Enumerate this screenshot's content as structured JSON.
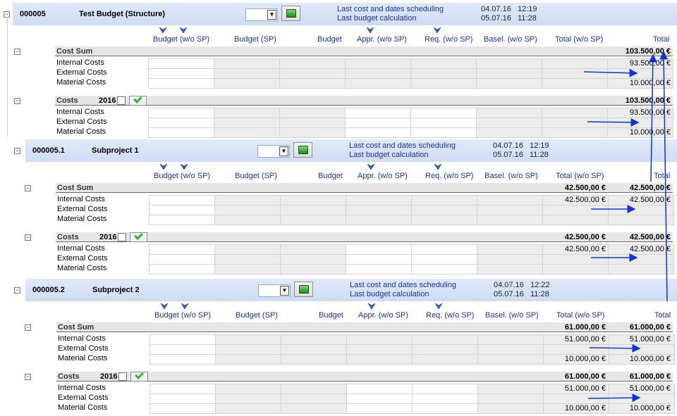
{
  "column_headers": [
    "Budget (w/o SP)",
    "Budget (SP)",
    "Budget",
    "Appr. (w/o SP)",
    "Req. (w/o SP)",
    "Basel. (w/o SP)",
    "Total (w/o SP)",
    "Total"
  ],
  "row_labels": [
    "Internal Costs",
    "External Costs",
    "Material Costs"
  ],
  "colors": {
    "accent": "#1b2fa8",
    "header_band": "#dae5f7",
    "arrow": "#1133dd"
  },
  "projects": [
    {
      "id": "000005",
      "name": "Test Budget (Structure)",
      "sched_label": "Last cost and dates scheduling",
      "calc_label": "Last budget calculation",
      "sched_date": "04.07.16",
      "sched_time": "12:19",
      "calc_date": "05.07.16",
      "calc_time": "11:28",
      "cost_sum": {
        "label": "Cost Sum",
        "total_wo_sp": "",
        "total": "103.500,00 €",
        "rows": [
          {
            "total_wo_sp": "",
            "total": "93.500,00 €"
          },
          {
            "total_wo_sp": "",
            "total": ""
          },
          {
            "total_wo_sp": "",
            "total": "10.000,00 €"
          }
        ]
      },
      "costs": {
        "label": "Costs",
        "year": "2016",
        "total_wo_sp": "",
        "total": "103.500,00 €",
        "rows": [
          {
            "total_wo_sp": "",
            "total": "93.500,00 €"
          },
          {
            "total_wo_sp": "",
            "total": ""
          },
          {
            "total_wo_sp": "",
            "total": "10.000,00 €"
          }
        ]
      }
    },
    {
      "id": "000005.1",
      "name": "Subproject 1",
      "sched_label": "Last cost and dates scheduling",
      "calc_label": "Last budget calculation",
      "sched_date": "04.07.16",
      "sched_time": "12:19",
      "calc_date": "05.07.16",
      "calc_time": "11:28",
      "cost_sum": {
        "label": "Cost Sum",
        "total_wo_sp": "42.500,00 €",
        "total": "42.500,00 €",
        "rows": [
          {
            "total_wo_sp": "42.500,00 €",
            "total": "42.500,00 €"
          },
          {
            "total_wo_sp": "",
            "total": ""
          },
          {
            "total_wo_sp": "",
            "total": ""
          }
        ]
      },
      "costs": {
        "label": "Costs",
        "year": "2016",
        "total_wo_sp": "42.500,00 €",
        "total": "42.500,00 €",
        "rows": [
          {
            "total_wo_sp": "42.500,00 €",
            "total": "42.500,00 €"
          },
          {
            "total_wo_sp": "",
            "total": ""
          },
          {
            "total_wo_sp": "",
            "total": ""
          }
        ]
      }
    },
    {
      "id": "000005.2",
      "name": "Subproject 2",
      "sched_label": "Last cost and dates scheduling",
      "calc_label": "Last budget calculation",
      "sched_date": "04.07.16",
      "sched_time": "12:22",
      "calc_date": "05.07.16",
      "calc_time": "11:28",
      "cost_sum": {
        "label": "Cost Sum",
        "total_wo_sp": "61.000,00 €",
        "total": "61.000,00 €",
        "rows": [
          {
            "total_wo_sp": "51.000,00 €",
            "total": "51.000,00 €"
          },
          {
            "total_wo_sp": "",
            "total": ""
          },
          {
            "total_wo_sp": "10.000,00 €",
            "total": "10.000,00 €"
          }
        ]
      },
      "costs": {
        "label": "Costs",
        "year": "2016",
        "total_wo_sp": "61.000,00 €",
        "total": "61.000,00 €",
        "rows": [
          {
            "total_wo_sp": "51.000,00 €",
            "total": "51.000,00 €"
          },
          {
            "total_wo_sp": "",
            "total": ""
          },
          {
            "total_wo_sp": "10.000,00 €",
            "total": "10.000,00 €"
          }
        ]
      }
    }
  ]
}
